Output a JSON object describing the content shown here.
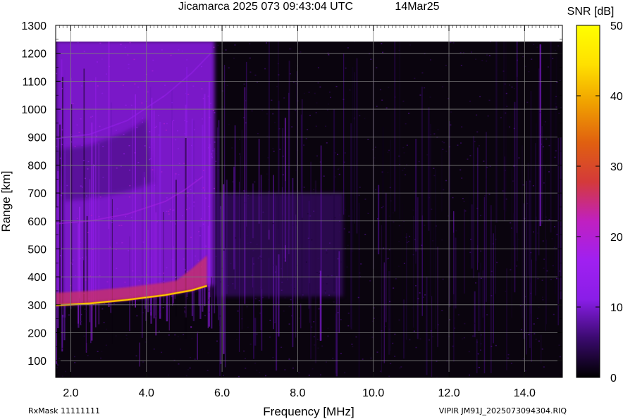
{
  "chart_data": {
    "type": "heatmap",
    "title": "Jicamarca 2025 073 09:43:04 UTC",
    "date_label": "14Mar25",
    "xlabel": "Frequency [MHz]",
    "ylabel": "Range [km]",
    "xlim": [
      1.6,
      15.0
    ],
    "ylim": [
      40,
      1300
    ],
    "data_range_top": 1245,
    "x_ticks": [
      2.0,
      4.0,
      6.0,
      8.0,
      10.0,
      12.0,
      14.0
    ],
    "x_tick_labels": [
      "2.0",
      "4.0",
      "6.0",
      "8.0",
      "10.0",
      "12.0",
      "14.0"
    ],
    "y_ticks": [
      100,
      200,
      300,
      400,
      500,
      600,
      700,
      800,
      900,
      1000,
      1100,
      1200,
      1300
    ],
    "y_tick_labels": [
      "100",
      "200",
      "300",
      "400",
      "500",
      "600",
      "700",
      "800",
      "900",
      "1000",
      "1100",
      "1200",
      "1300"
    ],
    "grid": true,
    "colorbar": {
      "label": "SNR [dB]",
      "min": 0,
      "max": 50,
      "ticks": [
        0,
        10,
        20,
        30,
        40,
        50
      ],
      "tick_labels": [
        "0",
        "10",
        "20",
        "30",
        "40",
        "50"
      ],
      "colors": [
        "#000000",
        "#3a0a6e",
        "#8a1ee8",
        "#a020f0",
        "#c020c0",
        "#d43a3a",
        "#e06010",
        "#f0a000",
        "#ffe000",
        "#ffff00"
      ]
    },
    "echo_traces": [
      {
        "name": "F-region trace",
        "points": [
          [
            1.6,
            298
          ],
          [
            2.5,
            305
          ],
          [
            3.5,
            318
          ],
          [
            4.5,
            335
          ],
          [
            5.2,
            352
          ],
          [
            5.6,
            368
          ]
        ],
        "snr_db": 38
      },
      {
        "name": "multiple echo lower edge",
        "points": [
          [
            1.6,
            590
          ],
          [
            2.5,
            600
          ],
          [
            3.5,
            625
          ],
          [
            4.5,
            670
          ],
          [
            5.0,
            710
          ],
          [
            5.5,
            760
          ]
        ],
        "snr_db": 14
      },
      {
        "name": "multiple echo upper edge",
        "points": [
          [
            1.6,
            895
          ],
          [
            2.5,
            910
          ],
          [
            3.5,
            960
          ],
          [
            4.5,
            1050
          ],
          [
            5.2,
            1130
          ],
          [
            5.7,
            1200
          ]
        ],
        "snr_db": 10
      }
    ],
    "strong_region": {
      "freq_range": [
        1.6,
        5.8
      ],
      "range_range": [
        295,
        1245
      ],
      "snr_db": 12
    },
    "weak_region": {
      "freq_range": [
        5.8,
        9.2
      ],
      "range_range": [
        330,
        700
      ],
      "snr_db": 6
    }
  },
  "footer": {
    "rx_mask": "RxMask 11111111",
    "file_label": "VIPIR  JM91J_2025073094304.RIQ"
  }
}
